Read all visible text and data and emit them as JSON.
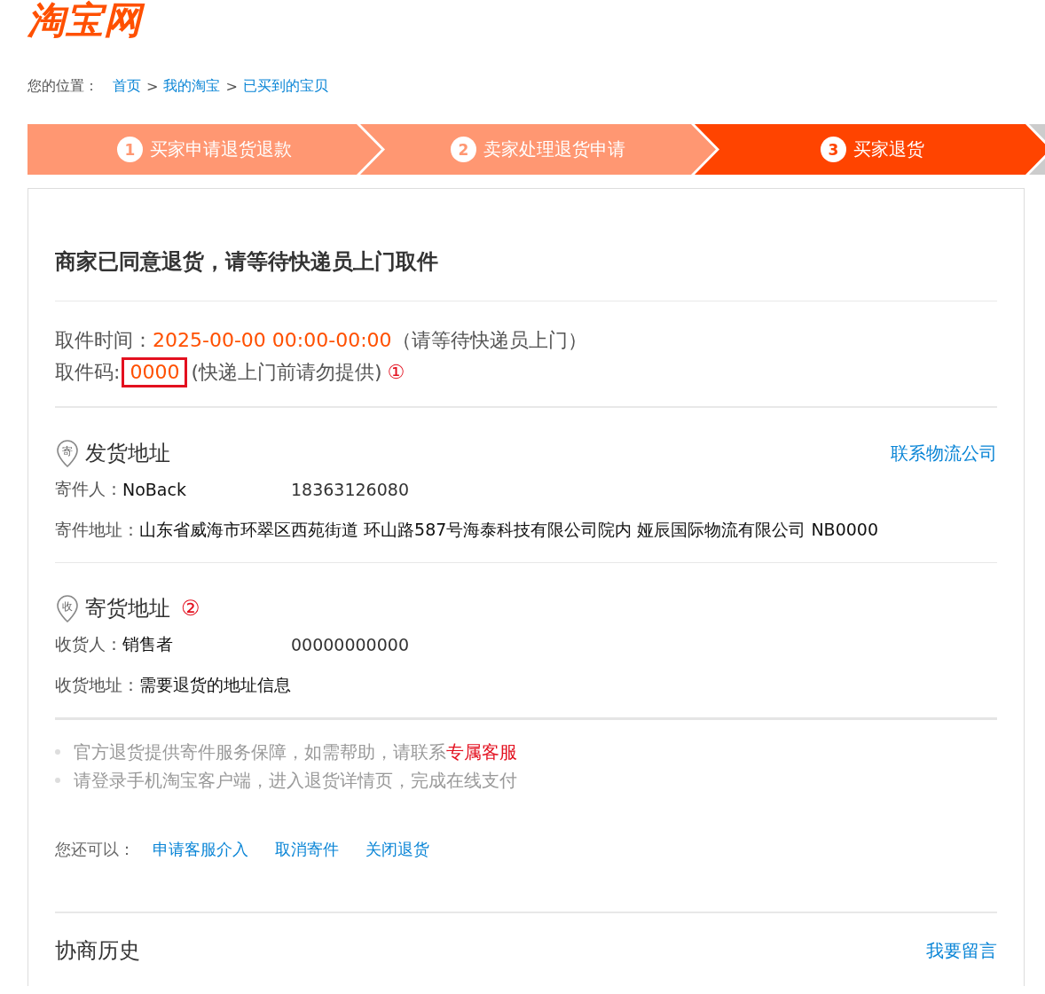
{
  "logo": "淘宝网",
  "breadcrumb": {
    "label": "您的位置：",
    "links": [
      "首页",
      "我的淘宝",
      "已买到的宝贝"
    ],
    "separator": ">"
  },
  "steps": [
    {
      "number": "1",
      "label": "买家申请退货退款",
      "selected": false
    },
    {
      "number": "2",
      "label": "卖家处理退货申请",
      "selected": false
    },
    {
      "number": "3",
      "label": "买家退货",
      "selected": true
    }
  ],
  "status_title": "商家已同意退货，请等待快递员上门取件",
  "pickup_time": {
    "label": "取件时间：",
    "value": "2025-00-00 00:00-00:00",
    "note": "（请等待快递员上门）"
  },
  "pickup_code": {
    "label": "取件码:",
    "value": "0000",
    "highlighted": true,
    "note": "(快递上门前请勿提供)",
    "annotation": "①"
  },
  "sender": {
    "icon_text": "寄",
    "title": "发货地址",
    "link": "联系物流公司",
    "name_label": "寄件人：",
    "name": "NoBack",
    "phone": "18363126080",
    "address_label": "寄件地址：",
    "address": "山东省威海市环翠区西苑街道 环山路587号海泰科技有限公司院内 娅辰国际物流有限公司 NB0000"
  },
  "receiver": {
    "icon_text": "收",
    "title": "寄货地址",
    "annotation": "②",
    "name_label": "收货人：",
    "name": "销售者",
    "phone": "00000000000",
    "address_label": "收货地址：",
    "address": "需要退货的地址信息"
  },
  "tips": [
    {
      "text": "官方退货提供寄件服务保障，如需帮助，请联系",
      "link": "专属客服"
    },
    {
      "text": "请登录手机淘宝客户端，进入退货详情页，完成在线支付"
    }
  ],
  "more_actions": {
    "label": "您还可以：",
    "links": [
      "申请客服介入",
      "取消寄件",
      "关闭退货"
    ]
  },
  "history": {
    "title": "协商历史",
    "link": "我要留言"
  }
}
